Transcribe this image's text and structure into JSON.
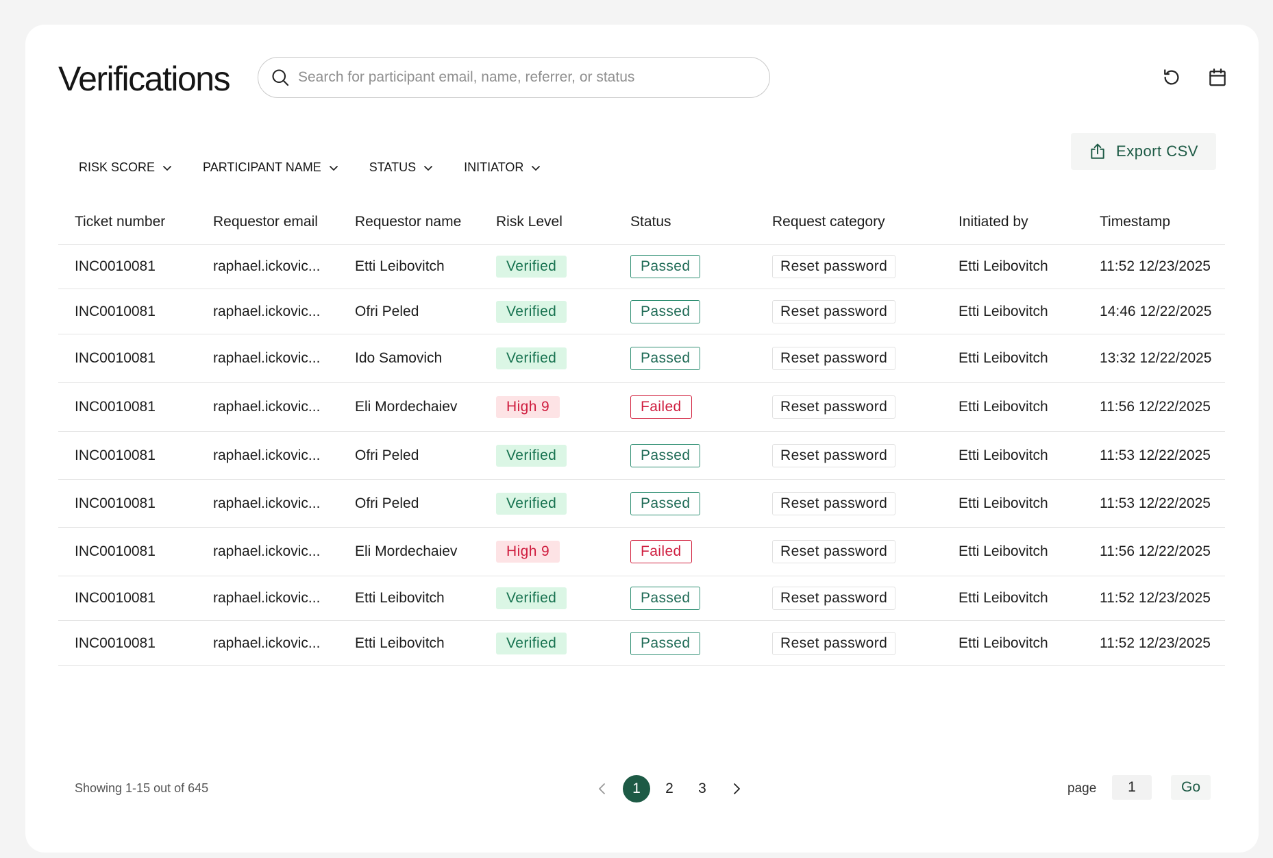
{
  "header": {
    "title": "Verifications",
    "search_placeholder": "Search for participant email, name, referrer, or status",
    "search_value": ""
  },
  "icons": {
    "search": "search-icon",
    "refresh": "refresh-icon",
    "calendar": "calendar-icon",
    "export": "export-icon",
    "chevron": "chevron-down-icon"
  },
  "filters": [
    {
      "label": "RISK SCORE"
    },
    {
      "label": "PARTICIPANT NAME"
    },
    {
      "label": "STATUS"
    },
    {
      "label": "INITIATOR"
    }
  ],
  "export_label": "Export CSV",
  "columns": [
    "Ticket number",
    "Requestor email",
    "Requestor name",
    "Risk Level",
    "Status",
    "Request category",
    "Initiated by",
    "Timestamp"
  ],
  "rows": [
    {
      "ticket": "INC0010081",
      "email": "raphael.ickovic...",
      "name": "Etti Leibovitch",
      "risk": "Verified",
      "risk_type": "verified",
      "status": "Passed",
      "status_type": "passed",
      "category": "Reset password",
      "initiator": "Etti Leibovitch",
      "timestamp": "11:52 12/23/2025"
    },
    {
      "ticket": "INC0010081",
      "email": "raphael.ickovic...",
      "name": "Ofri Peled",
      "risk": "Verified",
      "risk_type": "verified",
      "status": "Passed",
      "status_type": "passed",
      "category": "Reset password",
      "initiator": "Etti Leibovitch",
      "timestamp": "14:46 12/22/2025"
    },
    {
      "ticket": "INC0010081",
      "email": "raphael.ickovic...",
      "name": "Ido Samovich",
      "risk": "Verified",
      "risk_type": "verified",
      "status": "Passed",
      "status_type": "passed",
      "category": "Reset password",
      "initiator": "Etti Leibovitch",
      "timestamp": "13:32 12/22/2025"
    },
    {
      "ticket": "INC0010081",
      "email": "raphael.ickovic...",
      "name": "Eli Mordechaiev",
      "risk": "High 9",
      "risk_type": "high",
      "status": "Failed",
      "status_type": "failed",
      "category": "Reset password",
      "initiator": "Etti Leibovitch",
      "timestamp": "11:56 12/22/2025"
    },
    {
      "ticket": "INC0010081",
      "email": "raphael.ickovic...",
      "name": "Ofri Peled",
      "risk": "Verified",
      "risk_type": "verified",
      "status": "Passed",
      "status_type": "passed",
      "category": "Reset password",
      "initiator": "Etti Leibovitch",
      "timestamp": "11:53 12/22/2025"
    },
    {
      "ticket": "INC0010081",
      "email": "raphael.ickovic...",
      "name": "Ofri Peled",
      "risk": "Verified",
      "risk_type": "verified",
      "status": "Passed",
      "status_type": "passed",
      "category": "Reset password",
      "initiator": "Etti Leibovitch",
      "timestamp": "11:53 12/22/2025"
    },
    {
      "ticket": "INC0010081",
      "email": "raphael.ickovic...",
      "name": "Eli Mordechaiev",
      "risk": "High 9",
      "risk_type": "high",
      "status": "Failed",
      "status_type": "failed",
      "category": "Reset password",
      "initiator": "Etti Leibovitch",
      "timestamp": "11:56 12/22/2025"
    },
    {
      "ticket": "INC0010081",
      "email": "raphael.ickovic...",
      "name": "Etti Leibovitch",
      "risk": "Verified",
      "risk_type": "verified",
      "status": "Passed",
      "status_type": "passed",
      "category": "Reset password",
      "initiator": "Etti Leibovitch",
      "timestamp": "11:52 12/23/2025"
    },
    {
      "ticket": "INC0010081",
      "email": "raphael.ickovic...",
      "name": "Etti Leibovitch",
      "risk": "Verified",
      "risk_type": "verified",
      "status": "Passed",
      "status_type": "passed",
      "category": "Reset password",
      "initiator": "Etti Leibovitch",
      "timestamp": "11:52 12/23/2025"
    }
  ],
  "pagination": {
    "showing": "Showing 1-15 out of 645",
    "pages": [
      "1",
      "2",
      "3"
    ],
    "current": "1",
    "page_label": "page",
    "page_input": "1",
    "go_label": "Go"
  },
  "colors": {
    "accent": "#1d5a45",
    "verified_bg": "#dbf6e5",
    "verified_text": "#16724f",
    "high_bg": "#fde3e5",
    "high_text": "#cf1c3e",
    "passed_border": "#2f8f73",
    "failed_border": "#d2223f"
  }
}
